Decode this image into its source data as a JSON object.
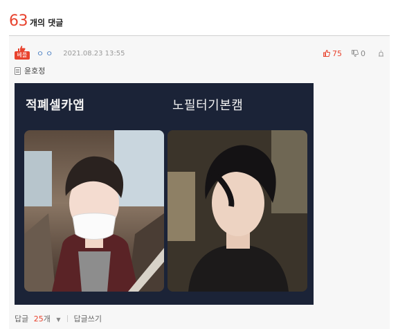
{
  "header": {
    "count": "63",
    "label": "개의 댓글"
  },
  "comment": {
    "badge": "베플",
    "nickname": "ㅇㅇ",
    "datetime": "2021.08.23 13:55",
    "upvotes": "75",
    "downvotes": "0",
    "subtitle": "윤호정",
    "image": {
      "left_title": "적폐셀카앱",
      "right_title": "노필터기본캠"
    },
    "footer": {
      "reply_label": "답글",
      "reply_count": "25",
      "reply_unit": "개",
      "write_reply": "답글쓰기"
    }
  },
  "colors": {
    "accent": "#e8432e",
    "nickname": "#4a7fc2",
    "image_bg": "#1b2337"
  },
  "icons": [
    "thumbs-up-icon",
    "thumbs-down-icon",
    "report-icon",
    "document-icon",
    "caret-down-icon"
  ]
}
